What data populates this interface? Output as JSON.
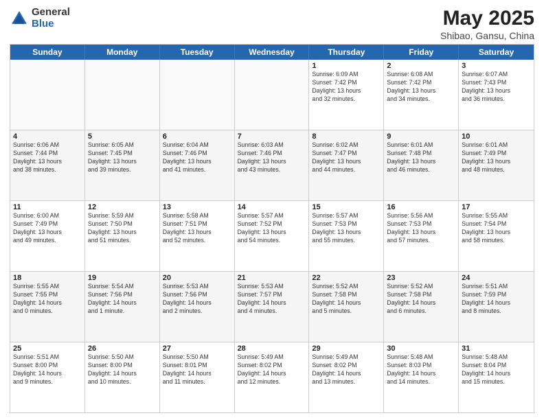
{
  "header": {
    "logo_general": "General",
    "logo_blue": "Blue",
    "title": "May 2025",
    "subtitle": "Shibao, Gansu, China"
  },
  "days_of_week": [
    "Sunday",
    "Monday",
    "Tuesday",
    "Wednesday",
    "Thursday",
    "Friday",
    "Saturday"
  ],
  "weeks": [
    [
      {
        "day": "",
        "info": ""
      },
      {
        "day": "",
        "info": ""
      },
      {
        "day": "",
        "info": ""
      },
      {
        "day": "",
        "info": ""
      },
      {
        "day": "1",
        "info": "Sunrise: 6:09 AM\nSunset: 7:42 PM\nDaylight: 13 hours\nand 32 minutes."
      },
      {
        "day": "2",
        "info": "Sunrise: 6:08 AM\nSunset: 7:42 PM\nDaylight: 13 hours\nand 34 minutes."
      },
      {
        "day": "3",
        "info": "Sunrise: 6:07 AM\nSunset: 7:43 PM\nDaylight: 13 hours\nand 36 minutes."
      }
    ],
    [
      {
        "day": "4",
        "info": "Sunrise: 6:06 AM\nSunset: 7:44 PM\nDaylight: 13 hours\nand 38 minutes."
      },
      {
        "day": "5",
        "info": "Sunrise: 6:05 AM\nSunset: 7:45 PM\nDaylight: 13 hours\nand 39 minutes."
      },
      {
        "day": "6",
        "info": "Sunrise: 6:04 AM\nSunset: 7:46 PM\nDaylight: 13 hours\nand 41 minutes."
      },
      {
        "day": "7",
        "info": "Sunrise: 6:03 AM\nSunset: 7:46 PM\nDaylight: 13 hours\nand 43 minutes."
      },
      {
        "day": "8",
        "info": "Sunrise: 6:02 AM\nSunset: 7:47 PM\nDaylight: 13 hours\nand 44 minutes."
      },
      {
        "day": "9",
        "info": "Sunrise: 6:01 AM\nSunset: 7:48 PM\nDaylight: 13 hours\nand 46 minutes."
      },
      {
        "day": "10",
        "info": "Sunrise: 6:01 AM\nSunset: 7:49 PM\nDaylight: 13 hours\nand 48 minutes."
      }
    ],
    [
      {
        "day": "11",
        "info": "Sunrise: 6:00 AM\nSunset: 7:49 PM\nDaylight: 13 hours\nand 49 minutes."
      },
      {
        "day": "12",
        "info": "Sunrise: 5:59 AM\nSunset: 7:50 PM\nDaylight: 13 hours\nand 51 minutes."
      },
      {
        "day": "13",
        "info": "Sunrise: 5:58 AM\nSunset: 7:51 PM\nDaylight: 13 hours\nand 52 minutes."
      },
      {
        "day": "14",
        "info": "Sunrise: 5:57 AM\nSunset: 7:52 PM\nDaylight: 13 hours\nand 54 minutes."
      },
      {
        "day": "15",
        "info": "Sunrise: 5:57 AM\nSunset: 7:53 PM\nDaylight: 13 hours\nand 55 minutes."
      },
      {
        "day": "16",
        "info": "Sunrise: 5:56 AM\nSunset: 7:53 PM\nDaylight: 13 hours\nand 57 minutes."
      },
      {
        "day": "17",
        "info": "Sunrise: 5:55 AM\nSunset: 7:54 PM\nDaylight: 13 hours\nand 58 minutes."
      }
    ],
    [
      {
        "day": "18",
        "info": "Sunrise: 5:55 AM\nSunset: 7:55 PM\nDaylight: 14 hours\nand 0 minutes."
      },
      {
        "day": "19",
        "info": "Sunrise: 5:54 AM\nSunset: 7:56 PM\nDaylight: 14 hours\nand 1 minute."
      },
      {
        "day": "20",
        "info": "Sunrise: 5:53 AM\nSunset: 7:56 PM\nDaylight: 14 hours\nand 2 minutes."
      },
      {
        "day": "21",
        "info": "Sunrise: 5:53 AM\nSunset: 7:57 PM\nDaylight: 14 hours\nand 4 minutes."
      },
      {
        "day": "22",
        "info": "Sunrise: 5:52 AM\nSunset: 7:58 PM\nDaylight: 14 hours\nand 5 minutes."
      },
      {
        "day": "23",
        "info": "Sunrise: 5:52 AM\nSunset: 7:58 PM\nDaylight: 14 hours\nand 6 minutes."
      },
      {
        "day": "24",
        "info": "Sunrise: 5:51 AM\nSunset: 7:59 PM\nDaylight: 14 hours\nand 8 minutes."
      }
    ],
    [
      {
        "day": "25",
        "info": "Sunrise: 5:51 AM\nSunset: 8:00 PM\nDaylight: 14 hours\nand 9 minutes."
      },
      {
        "day": "26",
        "info": "Sunrise: 5:50 AM\nSunset: 8:00 PM\nDaylight: 14 hours\nand 10 minutes."
      },
      {
        "day": "27",
        "info": "Sunrise: 5:50 AM\nSunset: 8:01 PM\nDaylight: 14 hours\nand 11 minutes."
      },
      {
        "day": "28",
        "info": "Sunrise: 5:49 AM\nSunset: 8:02 PM\nDaylight: 14 hours\nand 12 minutes."
      },
      {
        "day": "29",
        "info": "Sunrise: 5:49 AM\nSunset: 8:02 PM\nDaylight: 14 hours\nand 13 minutes."
      },
      {
        "day": "30",
        "info": "Sunrise: 5:48 AM\nSunset: 8:03 PM\nDaylight: 14 hours\nand 14 minutes."
      },
      {
        "day": "31",
        "info": "Sunrise: 5:48 AM\nSunset: 8:04 PM\nDaylight: 14 hours\nand 15 minutes."
      }
    ]
  ]
}
